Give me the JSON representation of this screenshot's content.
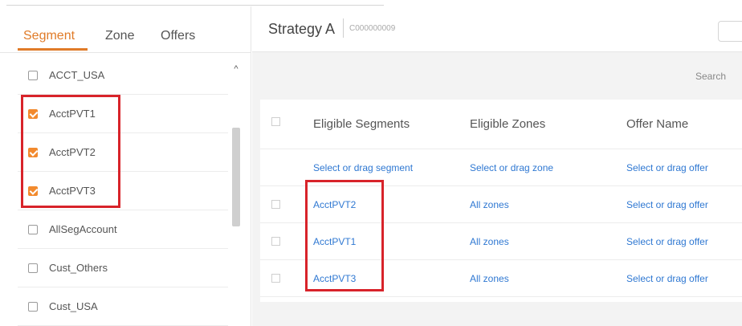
{
  "tabs": [
    "Segment",
    "Zone",
    "Offers"
  ],
  "segments": [
    {
      "label": "ACCT_USA",
      "checked": false
    },
    {
      "label": "AcctPVT1",
      "checked": true
    },
    {
      "label": "AcctPVT2",
      "checked": true
    },
    {
      "label": "AcctPVT3",
      "checked": true
    },
    {
      "label": "AllSegAccount",
      "checked": false
    },
    {
      "label": "Cust_Others",
      "checked": false
    },
    {
      "label": "Cust_USA",
      "checked": false
    }
  ],
  "scroll_up_glyph": "^",
  "header": {
    "title": "Strategy A",
    "id": "C000000009"
  },
  "search_label": "Search",
  "table": {
    "columns": [
      "Eligible Segments",
      "Eligible Zones",
      "Offer Name"
    ],
    "placeholder_row": [
      "Select or drag segment",
      "Select or drag zone",
      "Select or drag offer"
    ],
    "rows": [
      [
        "AcctPVT2",
        "All zones",
        "Select or drag offer"
      ],
      [
        "AcctPVT1",
        "All zones",
        "Select or drag offer"
      ],
      [
        "AcctPVT3",
        "All zones",
        "Select or drag offer"
      ]
    ]
  },
  "colors": {
    "accent": "#e07b28",
    "checkbox": "#f28a2e",
    "link": "#2f78d2",
    "highlight": "#d8232a"
  }
}
